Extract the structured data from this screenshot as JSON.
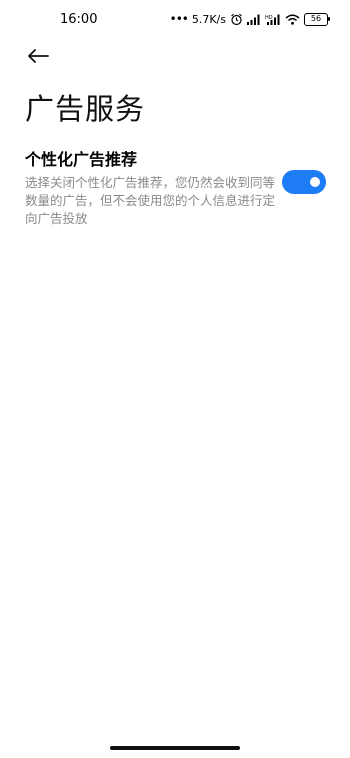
{
  "status_bar": {
    "time": "16:00",
    "dots": "•••",
    "speed": "5.7K/s",
    "battery": "56",
    "icons": [
      "alarm-icon",
      "signal-icon",
      "signal-hd-icon",
      "wifi-icon",
      "battery-icon"
    ]
  },
  "header": {
    "back_icon": "arrow-left-icon",
    "title": "广告服务"
  },
  "setting": {
    "title": "个性化广告推荐",
    "description": "选择关闭个性化广告推荐，您仍然会收到同等数量的广告，但不会使用您的个人信息进行定向广告投放",
    "enabled": true
  },
  "colors": {
    "accent": "#1e7cf5",
    "secondary_text": "#8a8a8a"
  }
}
